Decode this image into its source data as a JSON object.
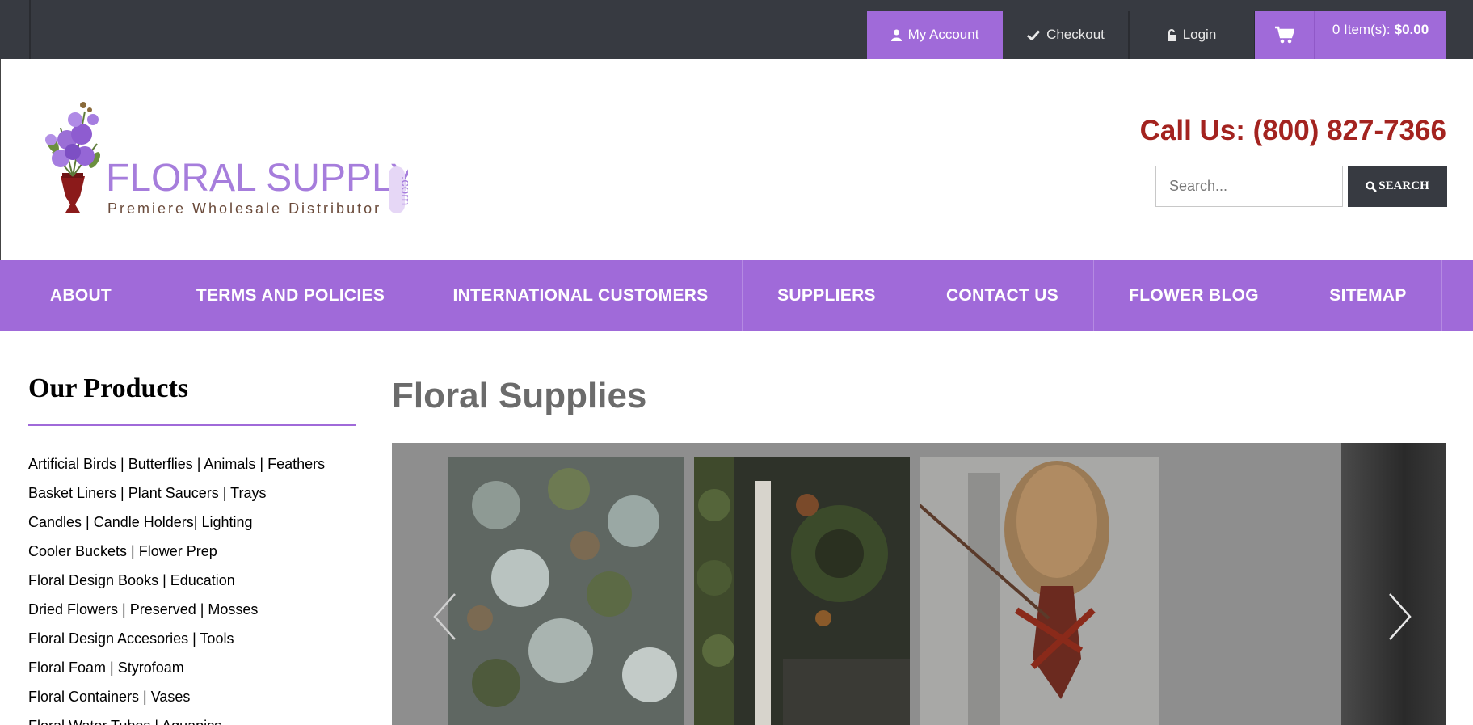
{
  "topbar": {
    "account_label": "My Account",
    "checkout_label": "Checkout",
    "login_label": "Login",
    "cart_count_label": "0 Item(s):",
    "cart_total": "$0.00",
    "icons": [
      "user-icon",
      "check-icon",
      "lock-icon",
      "cart-icon"
    ]
  },
  "header": {
    "logo_text": "FLORAL SUPPLY",
    "logo_com": ".com",
    "logo_tagline": "Premiere Wholesale Distributor",
    "call_us": "Call Us: (800) 827-7366",
    "search_placeholder": "Search...",
    "search_button": "SEARCH"
  },
  "nav": {
    "items": [
      {
        "label": "ABOUT"
      },
      {
        "label": "TERMS AND POLICIES"
      },
      {
        "label": "INTERNATIONAL CUSTOMERS"
      },
      {
        "label": "SUPPLIERS"
      },
      {
        "label": "CONTACT US"
      },
      {
        "label": "FLOWER BLOG"
      },
      {
        "label": "SITEMAP"
      }
    ]
  },
  "sidebar": {
    "title": "Our Products",
    "items": [
      "Artificial Birds | Butterflies | Animals | Feathers",
      "Basket Liners | Plant Saucers | Trays",
      "Candles | Candle Holders| Lighting",
      "Cooler Buckets | Flower Prep",
      "Floral Design Books | Education",
      "Dried Flowers | Preserved | Mosses",
      "Floral Design Accesories | Tools",
      "Floral Foam | Styrofoam",
      "Floral Containers | Vases",
      "Floral Water Tubes | Aquapics"
    ]
  },
  "main": {
    "title": "Floral Supplies"
  },
  "colors": {
    "accent": "#a06ad9",
    "dark": "#373a41",
    "phone": "#a3231f"
  }
}
